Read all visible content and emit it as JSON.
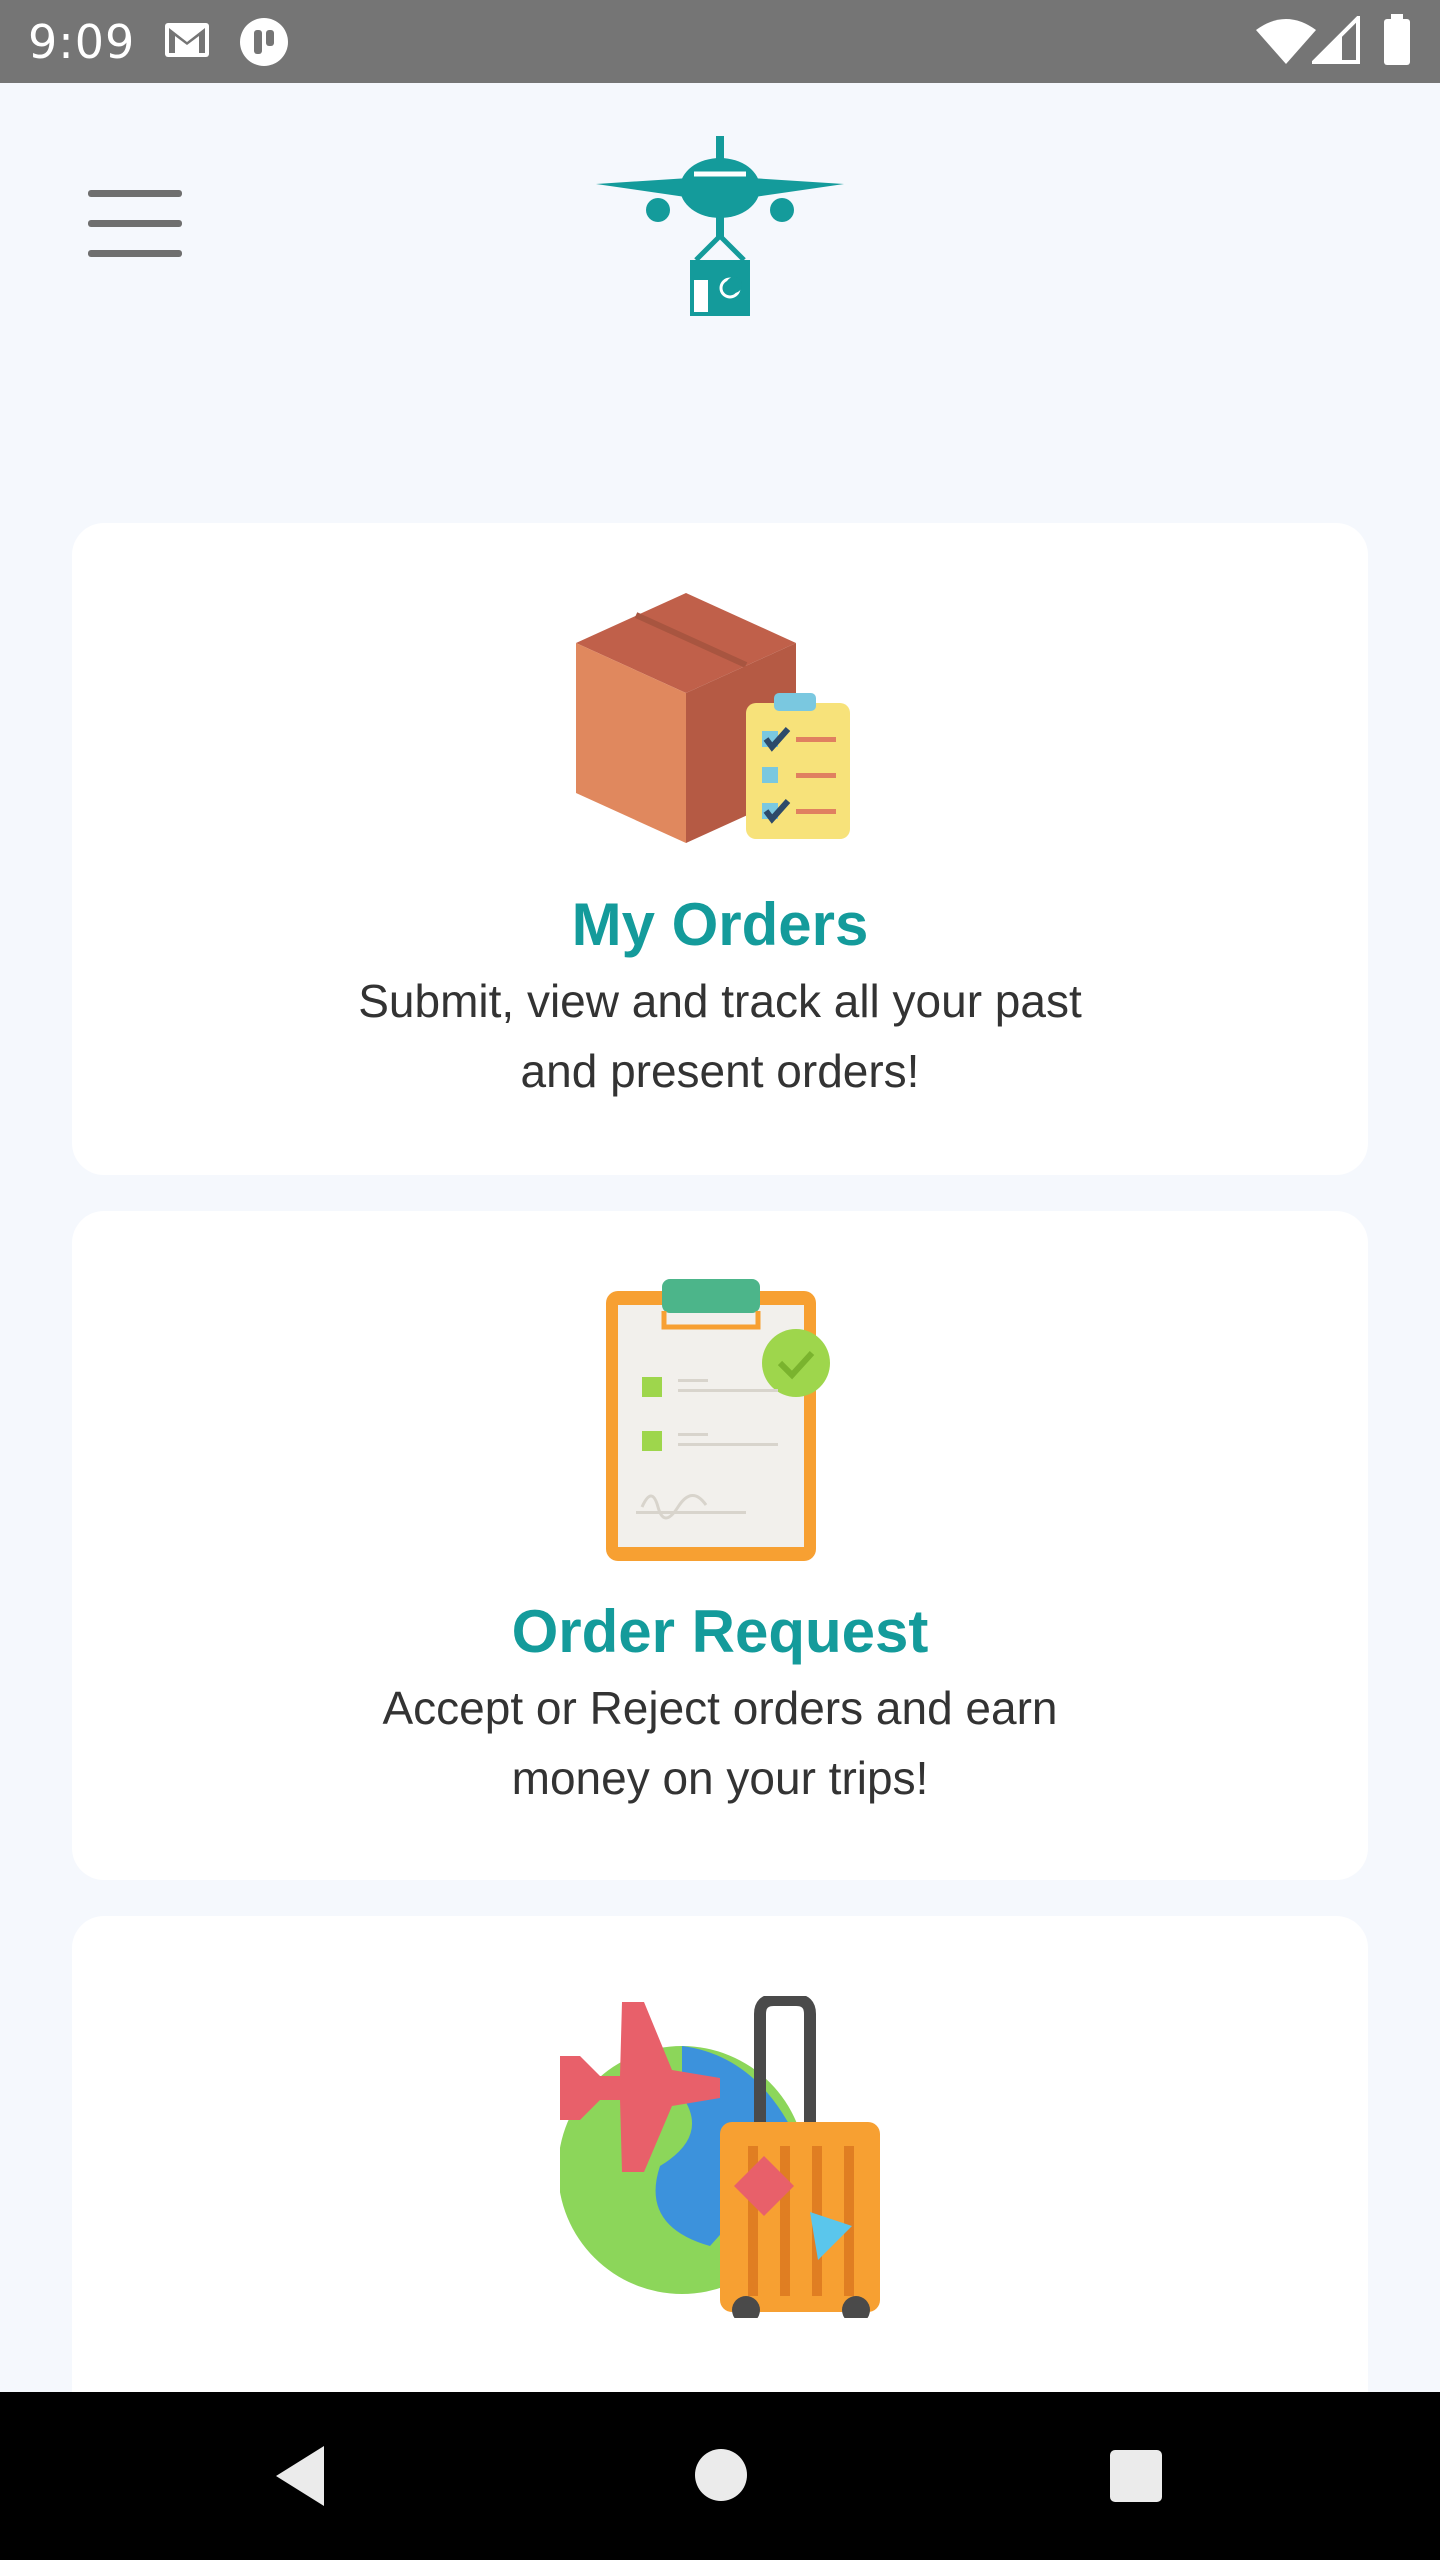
{
  "status_bar": {
    "time": "9:09",
    "left_icons": [
      "gmail-icon",
      "app-notification-icon"
    ],
    "right_icons": [
      "wifi-icon",
      "cell-signal-icon",
      "battery-icon"
    ]
  },
  "header": {
    "menu_icon": "hamburger-menu-icon",
    "logo_icon": "airplane-package-logo-icon",
    "brand_color": "#149b9b"
  },
  "cards": [
    {
      "title": "My Orders",
      "description_line1": "Submit, view and track all your past",
      "description_line2": "and present orders!",
      "icon": "box-clipboard-icon"
    },
    {
      "title": "Order Request",
      "description_line1": "Accept or Reject orders and earn",
      "description_line2": "money on your trips!",
      "icon": "clipboard-check-icon"
    },
    {
      "title": "",
      "icon": "globe-plane-luggage-icon"
    }
  ],
  "nav_bar": {
    "back_icon": "back-triangle-icon",
    "home_icon": "home-circle-icon",
    "recents_icon": "recents-square-icon"
  }
}
